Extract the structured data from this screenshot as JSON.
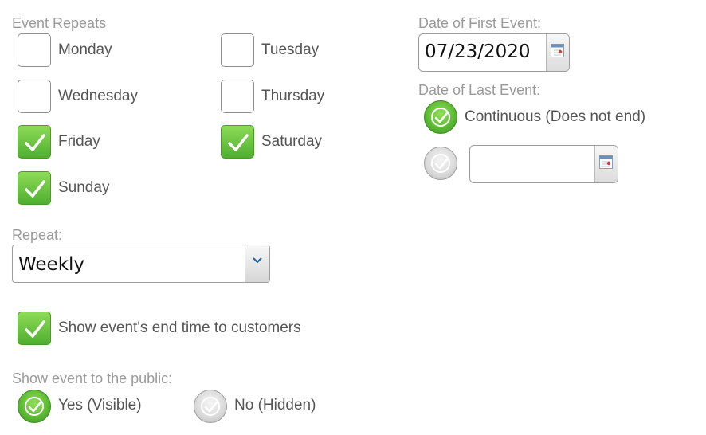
{
  "event_repeats": {
    "label": "Event Repeats",
    "days": [
      {
        "label": "Monday",
        "checked": false
      },
      {
        "label": "Tuesday",
        "checked": false
      },
      {
        "label": "Wednesday",
        "checked": false
      },
      {
        "label": "Thursday",
        "checked": false
      },
      {
        "label": "Friday",
        "checked": true
      },
      {
        "label": "Saturday",
        "checked": true
      },
      {
        "label": "Sunday",
        "checked": true
      }
    ]
  },
  "repeat": {
    "label": "Repeat:",
    "value": "Weekly"
  },
  "show_end_time": {
    "label": "Show event's end time to customers",
    "checked": true
  },
  "public": {
    "label": "Show event to the public:",
    "yes_label": "Yes (Visible)",
    "no_label": "No (Hidden)",
    "selected": "yes"
  },
  "first_event": {
    "label": "Date of First Event:",
    "value": "07/23/2020"
  },
  "last_event": {
    "label": "Date of Last Event:",
    "continuous_label": "Continuous (Does not end)",
    "selected": "continuous",
    "end_date_value": ""
  },
  "colors": {
    "checked_green": "#5cbc33",
    "label_gray": "#9a9a9a",
    "text_gray": "#555555"
  }
}
